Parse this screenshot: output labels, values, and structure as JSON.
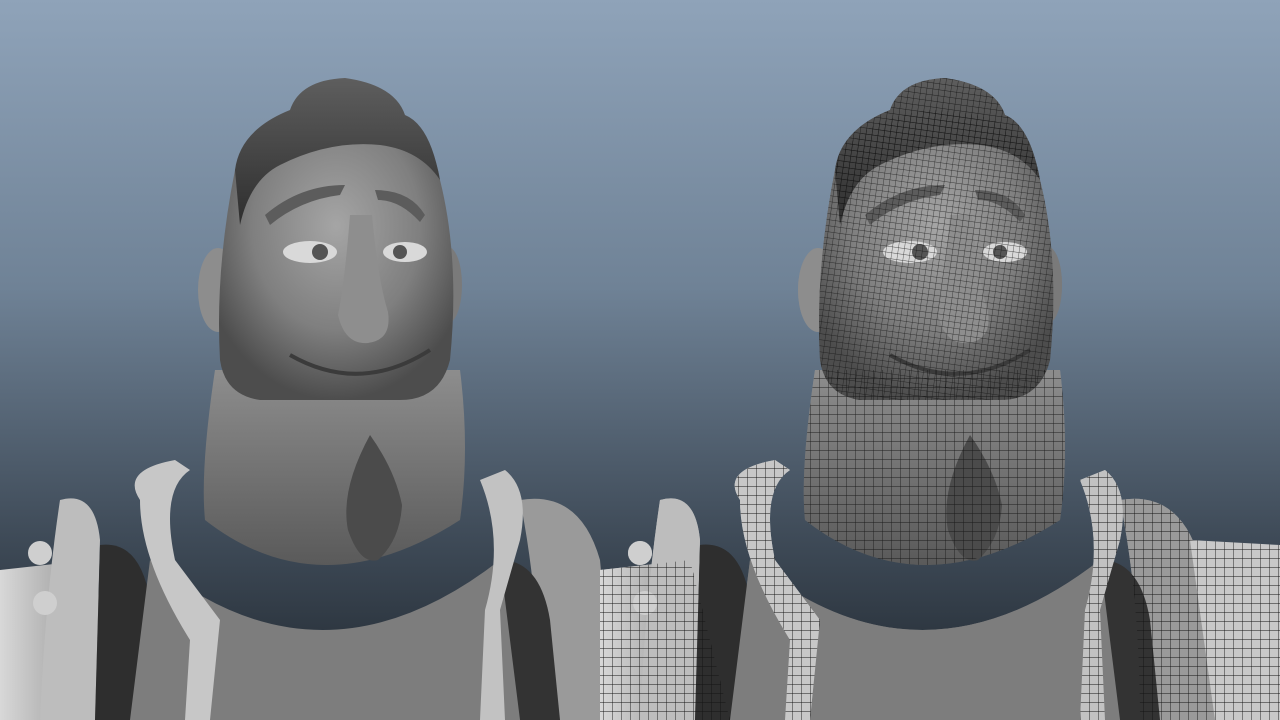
{
  "scene": {
    "viewports": [
      {
        "id": "shaded",
        "mode": "smooth-shaded"
      },
      {
        "id": "wireframe",
        "mode": "wireframe-on-shaded"
      }
    ],
    "colors": {
      "background_top": "#8fa3b9",
      "background_bottom": "#1f262d",
      "skin": "#8a8a8a",
      "skin_highlight": "#b8b8b8",
      "hair": "#4a4a4a",
      "wire": "#1a1a1a"
    }
  }
}
